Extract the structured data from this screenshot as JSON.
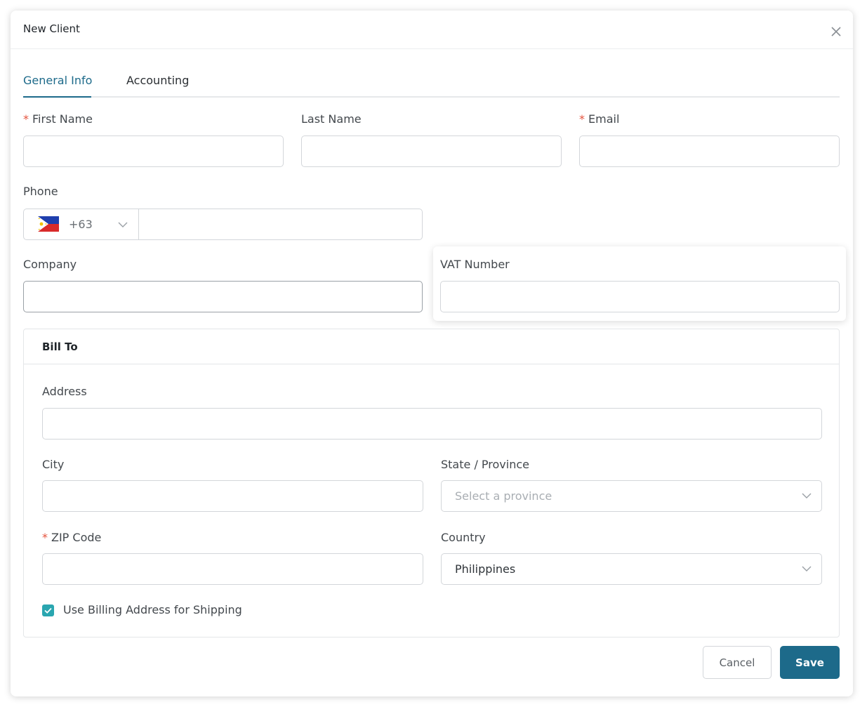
{
  "dialog": {
    "title": "New Client"
  },
  "tabs": [
    {
      "label": "General Info",
      "active": true
    },
    {
      "label": "Accounting",
      "active": false
    }
  ],
  "fields": {
    "first_name": {
      "label": "First Name",
      "required": "*",
      "value": ""
    },
    "last_name": {
      "label": "Last Name",
      "value": ""
    },
    "email": {
      "label": "Email",
      "required": "*",
      "value": ""
    },
    "phone": {
      "label": "Phone",
      "country_code": "+63",
      "flag": "philippines-flag-icon",
      "value": ""
    },
    "company": {
      "label": "Company",
      "value": ""
    },
    "vat_number": {
      "label": "VAT Number",
      "value": ""
    }
  },
  "bill_to": {
    "title": "Bill To",
    "address": {
      "label": "Address",
      "value": ""
    },
    "city": {
      "label": "City",
      "value": ""
    },
    "state": {
      "label": "State / Province",
      "placeholder": "Select a province"
    },
    "zip": {
      "label": "ZIP Code",
      "required": "*",
      "value": ""
    },
    "country": {
      "label": "Country",
      "value": "Philippines"
    },
    "use_billing_for_shipping": {
      "label": "Use Billing Address for Shipping",
      "checked": true
    }
  },
  "actions": {
    "cancel": "Cancel",
    "save": "Save"
  },
  "colors": {
    "accent": "#1d6a8a",
    "required": "#e5533d",
    "checkbox": "#2aa6b0"
  }
}
